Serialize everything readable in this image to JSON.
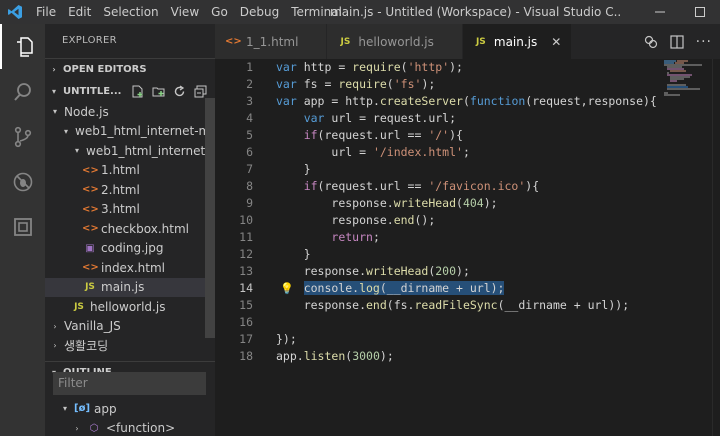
{
  "titlebar": {
    "menu": [
      "File",
      "Edit",
      "Selection",
      "View",
      "Go",
      "Debug",
      "Terminal"
    ],
    "window_title": "main.js - Untitled (Workspace) - Visual Studio C..."
  },
  "activitybar": {
    "icons": [
      "files-icon",
      "search-icon",
      "source-control-icon",
      "debug-icon",
      "extensions-icon"
    ]
  },
  "sidebar": {
    "header": "EXPLORER",
    "open_editors": "OPEN EDITORS",
    "workspace": "UNTITLE...",
    "tree": [
      {
        "label": "Node.js",
        "depth": 1,
        "twisty": "▾",
        "type": "folder"
      },
      {
        "label": "web1_html_internet-m...",
        "depth": 2,
        "twisty": "▾",
        "type": "folder"
      },
      {
        "label": "web1_html_internet-...",
        "depth": 3,
        "twisty": "▾",
        "type": "folder"
      },
      {
        "label": "1.html",
        "depth": 4,
        "type": "html"
      },
      {
        "label": "2.html",
        "depth": 4,
        "type": "html"
      },
      {
        "label": "3.html",
        "depth": 4,
        "type": "html"
      },
      {
        "label": "checkbox.html",
        "depth": 4,
        "type": "html"
      },
      {
        "label": "coding.jpg",
        "depth": 4,
        "type": "img"
      },
      {
        "label": "index.html",
        "depth": 4,
        "type": "html"
      },
      {
        "label": "main.js",
        "depth": 4,
        "type": "js",
        "selected": true
      },
      {
        "label": "helloworld.js",
        "depth": 3,
        "type": "js"
      },
      {
        "label": "Vanilla_JS",
        "depth": 1,
        "twisty": "›",
        "type": "folder"
      },
      {
        "label": "생활코딩",
        "depth": 1,
        "twisty": "›",
        "type": "folder"
      }
    ],
    "outline": "OUTLINE",
    "filter_placeholder": "Filter",
    "outline_items": [
      {
        "label": "app",
        "twisty": "▾",
        "icon": "[ø]"
      },
      {
        "label": "<function>",
        "twisty": "›",
        "icon": "⬡"
      }
    ]
  },
  "tabs": [
    {
      "label": "1_1.html",
      "icon": "<>",
      "type": "html",
      "active": false
    },
    {
      "label": "helloworld.js",
      "icon": "JS",
      "type": "js",
      "active": false
    },
    {
      "label": "main.js",
      "icon": "JS",
      "type": "js",
      "active": true
    }
  ],
  "editor": {
    "current_line": 14,
    "lines": [
      {
        "n": 1,
        "indent": 0,
        "tokens": [
          [
            "kw",
            "var"
          ],
          [
            "p",
            " http = "
          ],
          [
            "fn",
            "require"
          ],
          [
            "p",
            "("
          ],
          [
            "str",
            "'http'"
          ],
          [
            "p",
            ");"
          ]
        ]
      },
      {
        "n": 2,
        "indent": 0,
        "tokens": [
          [
            "kw",
            "var"
          ],
          [
            "p",
            " fs = "
          ],
          [
            "fn",
            "require"
          ],
          [
            "p",
            "("
          ],
          [
            "str",
            "'fs'"
          ],
          [
            "p",
            ");"
          ]
        ]
      },
      {
        "n": 3,
        "indent": 0,
        "tokens": [
          [
            "kw",
            "var"
          ],
          [
            "p",
            " app = http."
          ],
          [
            "fn",
            "createServer"
          ],
          [
            "p",
            "("
          ],
          [
            "kw",
            "function"
          ],
          [
            "p",
            "(request,response){"
          ]
        ]
      },
      {
        "n": 4,
        "indent": 1,
        "tokens": [
          [
            "kw",
            "var"
          ],
          [
            "p",
            " url = request.url;"
          ]
        ]
      },
      {
        "n": 5,
        "indent": 1,
        "tokens": [
          [
            "kw2",
            "if"
          ],
          [
            "p",
            "(request.url == "
          ],
          [
            "str",
            "'/'"
          ],
          [
            "p",
            "){"
          ]
        ]
      },
      {
        "n": 6,
        "indent": 2,
        "tokens": [
          [
            "p",
            "url = "
          ],
          [
            "str",
            "'/index.html'"
          ],
          [
            "p",
            ";"
          ]
        ]
      },
      {
        "n": 7,
        "indent": 1,
        "tokens": [
          [
            "p",
            "}"
          ]
        ]
      },
      {
        "n": 8,
        "indent": 1,
        "tokens": [
          [
            "kw2",
            "if"
          ],
          [
            "p",
            "(request.url == "
          ],
          [
            "str",
            "'/favicon.ico'"
          ],
          [
            "p",
            "){"
          ]
        ]
      },
      {
        "n": 9,
        "indent": 2,
        "tokens": [
          [
            "p",
            "response."
          ],
          [
            "fn",
            "writeHead"
          ],
          [
            "p",
            "("
          ],
          [
            "num",
            "404"
          ],
          [
            "p",
            ");"
          ]
        ]
      },
      {
        "n": 10,
        "indent": 2,
        "tokens": [
          [
            "p",
            "response."
          ],
          [
            "fn",
            "end"
          ],
          [
            "p",
            "();"
          ]
        ]
      },
      {
        "n": 11,
        "indent": 2,
        "tokens": [
          [
            "kw2",
            "return"
          ],
          [
            "p",
            ";"
          ]
        ]
      },
      {
        "n": 12,
        "indent": 1,
        "tokens": [
          [
            "p",
            "}"
          ]
        ]
      },
      {
        "n": 13,
        "indent": 1,
        "tokens": [
          [
            "p",
            "response."
          ],
          [
            "fn",
            "writeHead"
          ],
          [
            "p",
            "("
          ],
          [
            "num",
            "200"
          ],
          [
            "p",
            ");"
          ]
        ]
      },
      {
        "n": 14,
        "indent": 1,
        "selected": true,
        "tokens": [
          [
            "p",
            "console."
          ],
          [
            "fn",
            "log"
          ],
          [
            "p",
            "(__dirname + url);"
          ]
        ]
      },
      {
        "n": 15,
        "indent": 1,
        "tokens": [
          [
            "p",
            "response."
          ],
          [
            "fn",
            "end"
          ],
          [
            "p",
            "(fs."
          ],
          [
            "fn",
            "readFileSync"
          ],
          [
            "p",
            "(__dirname + url));"
          ]
        ]
      },
      {
        "n": 16,
        "indent": 0,
        "tokens": []
      },
      {
        "n": 17,
        "indent": 0,
        "tokens": [
          [
            "p",
            "});"
          ]
        ]
      },
      {
        "n": 18,
        "indent": 0,
        "tokens": [
          [
            "p",
            "app."
          ],
          [
            "fn",
            "listen"
          ],
          [
            "p",
            "("
          ],
          [
            "num",
            "3000"
          ],
          [
            "p",
            ");"
          ]
        ]
      }
    ]
  },
  "colors": {
    "accent": "#007acc",
    "keyword": "#569cd6",
    "control": "#c586c0",
    "string": "#ce9178",
    "function": "#dcdcaa",
    "number": "#b5cea8",
    "selection": "#264f78"
  }
}
